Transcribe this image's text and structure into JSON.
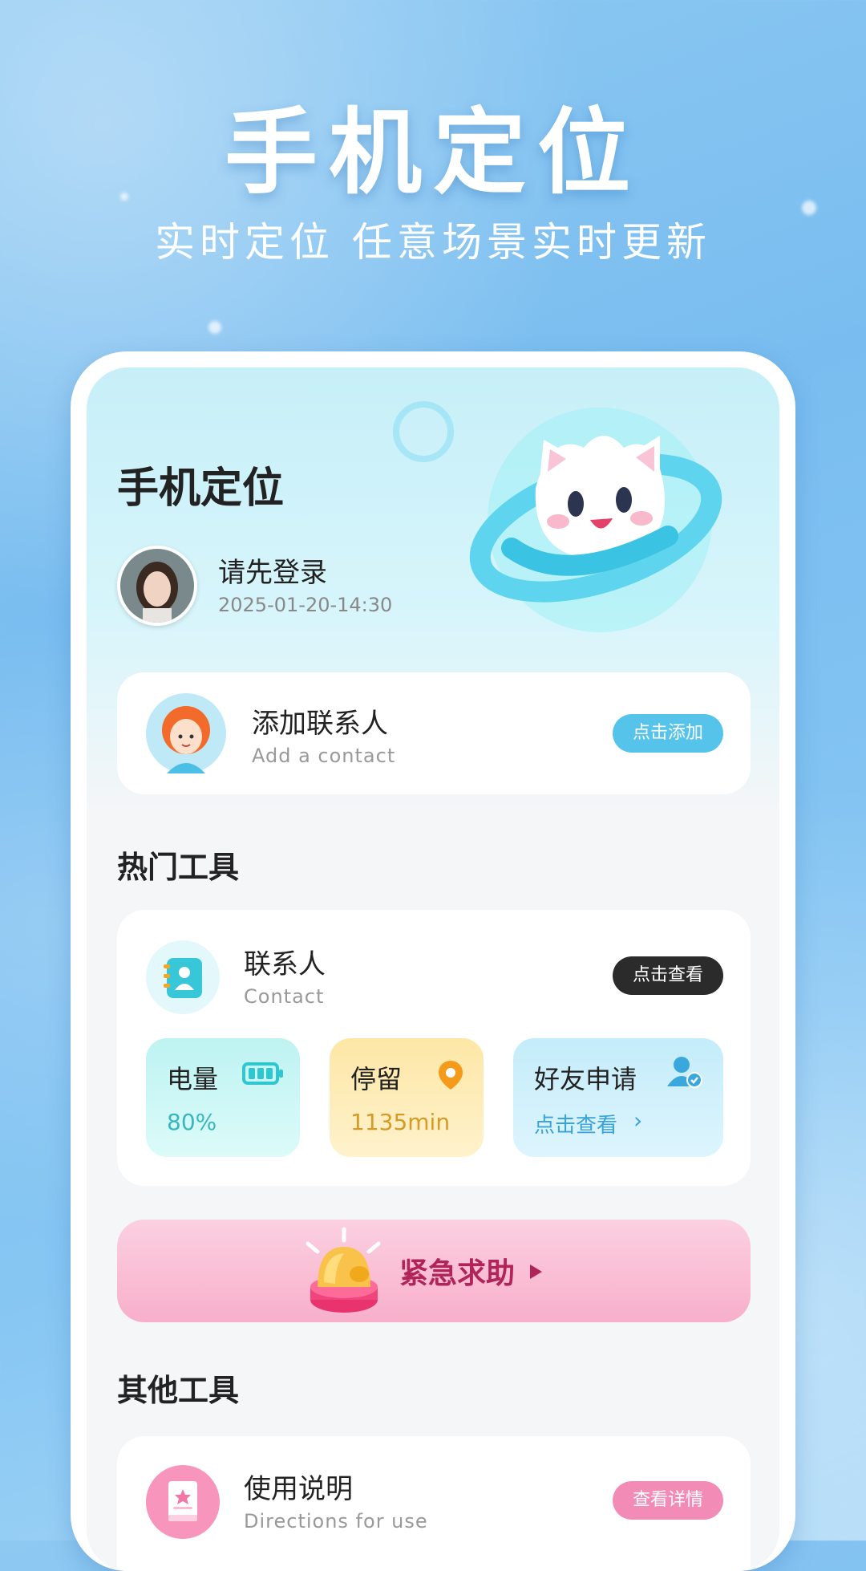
{
  "hero": {
    "title": "手机定位",
    "subtitle": "实时定位 任意场景实时更新"
  },
  "header": {
    "app_title": "手机定位",
    "login_prompt": "请先登录",
    "timestamp": "2025-01-20-14:30"
  },
  "add_contact": {
    "title": "添加联系人",
    "subtitle": "Add a contact",
    "button": "点击添加"
  },
  "hot_tools": {
    "section_title": "热门工具",
    "contact": {
      "title": "联系人",
      "subtitle": "Contact",
      "button": "点击查看"
    },
    "tiles": [
      {
        "title": "电量",
        "value": "80%",
        "icon": "battery-icon"
      },
      {
        "title": "停留",
        "value": "1135min",
        "icon": "location-pin-icon"
      },
      {
        "title": "好友申请",
        "value": "点击查看",
        "icon": "friend-verified-icon"
      }
    ]
  },
  "sos": {
    "label": "紧急求助"
  },
  "other_tools": {
    "section_title": "其他工具",
    "guide": {
      "title": "使用说明",
      "subtitle": "Directions for use",
      "button": "查看详情"
    }
  },
  "colors": {
    "accent_blue": "#4fc3e6",
    "pink": "#f28bb6",
    "dark_pill": "#2b2b2b"
  }
}
